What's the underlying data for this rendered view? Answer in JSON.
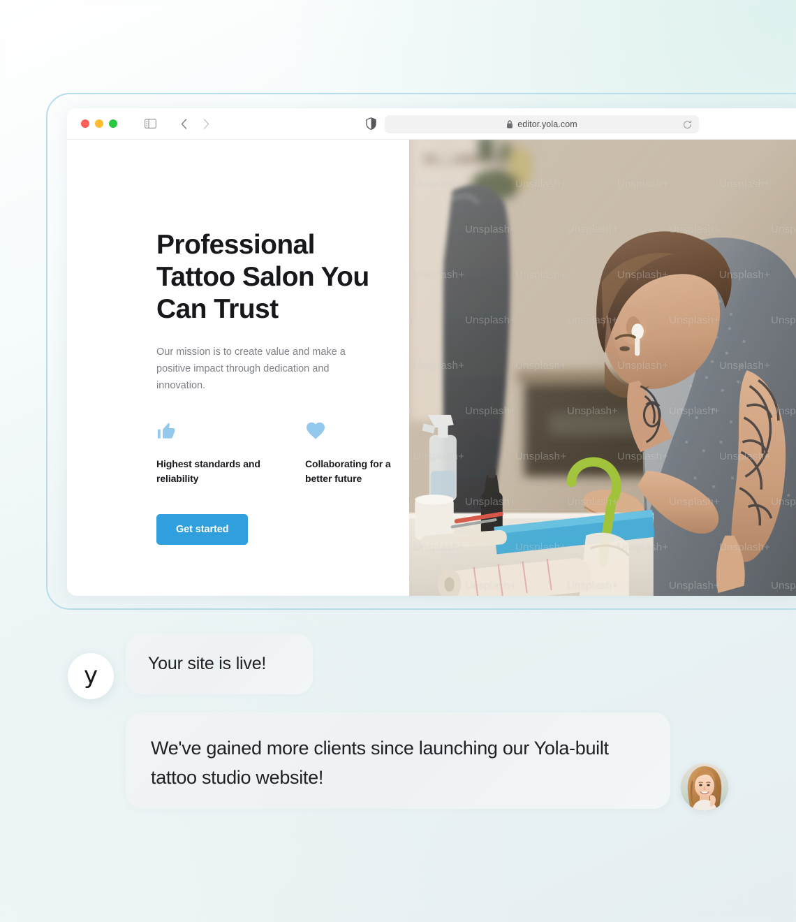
{
  "browser": {
    "url": "editor.yola.com",
    "lock_icon": "lock-icon",
    "reload_icon": "reload-icon",
    "shield_icon": "shield-privacy-icon",
    "sidebar_icon": "sidebar-toggle-icon",
    "back_icon": "chevron-left-icon",
    "forward_icon": "chevron-right-icon",
    "traffic_lights": {
      "close": "#ff5f57",
      "minimize": "#febc2e",
      "maximize": "#28c840"
    }
  },
  "site": {
    "hero": {
      "title": "Professional Tattoo Salon You Can Trust",
      "subtitle": "Our mission is to create value and make a positive impact through dedication and innovation.",
      "cta_label": "Get started",
      "cta_color": "#2f9fdd"
    },
    "features": [
      {
        "icon": "thumbs-up-icon",
        "label": "Highest standards and reliability",
        "color": "#93c9ec"
      },
      {
        "icon": "heart-icon",
        "label": "Collaborating for a better future",
        "color": "#93c9ec"
      }
    ],
    "photo": {
      "alt": "Tattoo artist in gray sweater with neck and arm tattoos wearing an earbud, preparing equipment at a workstation",
      "watermark_text": "Unsplash+"
    }
  },
  "chat": {
    "brand_letter": "y",
    "messages": [
      {
        "author": "yola",
        "text": "Your site is live!"
      },
      {
        "author": "customer",
        "text": "We've gained more clients since launching our Yola-built tattoo studio website!"
      }
    ],
    "customer_avatar": "smiling-woman-photo-avatar"
  },
  "theme": {
    "background_top_right": "#def1ef",
    "background_bottom": "#e6eef1",
    "frame_border": "#b8dcea",
    "bubble_background": "#f1f4f4"
  }
}
